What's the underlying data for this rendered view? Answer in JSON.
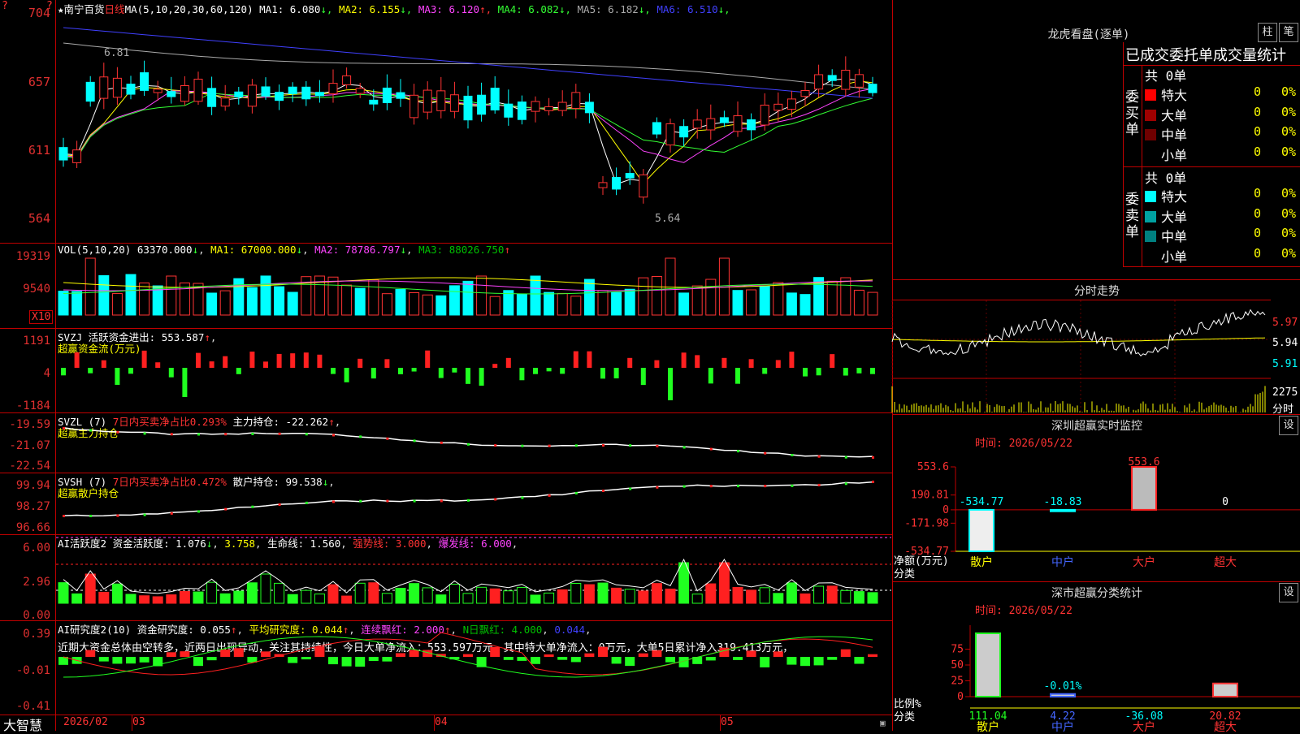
{
  "stock": {
    "name": "南宁百货",
    "star": "★",
    "period": "日线",
    "ma_header": "MA(5,10,20,30,60,120)",
    "ma": [
      {
        "label": "MA1: 6.080",
        "arrow": "↓",
        "color": "#ffffff"
      },
      {
        "label": "MA2: 6.155",
        "arrow": "↓",
        "color": "#ffff00"
      },
      {
        "label": "MA3: 6.120",
        "arrow": "↑",
        "color": "#ff44ff"
      },
      {
        "label": "MA4: 6.082",
        "arrow": "↓",
        "color": "#33ff33"
      },
      {
        "label": "MA5: 6.182",
        "arrow": "↓",
        "color": "#aaaaaa"
      },
      {
        "label": "MA6: 6.510",
        "arrow": "↓",
        "color": "#4040ff"
      }
    ],
    "y_ticks": [
      "704",
      "657",
      "611",
      "564"
    ],
    "high_label": "6.81",
    "low_label": "5.64",
    "top_marker": "?"
  },
  "vol": {
    "header": "VOL(5,10,20)",
    "value": "63370.000",
    "ma1": "MA1: 67000.000",
    "ma2": "MA2: 78786.797",
    "ma3": "MA3: 88026.750",
    "y_ticks": [
      "19319",
      "9540"
    ],
    "unit": "X10"
  },
  "svzj": {
    "header": "SVZJ",
    "label": "活跃资金进出: 553.587",
    "arrow": "↑",
    "subtitle": "超赢资金流(万元)",
    "y_ticks": [
      "1191",
      "4",
      "-1184"
    ]
  },
  "svzl": {
    "header": "SVZL (7)",
    "ratio": "7日内买卖净占比0.293%",
    "hold": "主力持仓: -22.262",
    "arrow": "↑",
    "subtitle": "超赢主力持仓",
    "y_ticks": [
      "-19.59",
      "-21.07",
      "-22.54"
    ]
  },
  "svsh": {
    "header": "SVSH (7)",
    "ratio": "7日内买卖净占比0.472%",
    "hold": "散户持仓: 99.538",
    "arrow": "↓",
    "subtitle": "超赢散户持仓",
    "y_ticks": [
      "99.94",
      "98.27",
      "96.66"
    ]
  },
  "ai2": {
    "header": "AI活跃度2",
    "activity": "资金活跃度: 1.076",
    "activity_arrow": "↓",
    "v2": "3.758",
    "life": "生命线: 1.560",
    "strong": "强势线: 3.000",
    "burst": "爆发线: 6.000",
    "y_ticks": [
      "6.00",
      "2.96",
      "0.00"
    ]
  },
  "ai_research": {
    "header": "AI研究度2(10)",
    "research": "资金研究度: 0.055",
    "avg": "平均研究度: 0.044",
    "consec": "连续飘红: 2.000",
    "ndays": "N日飘红: 4.000",
    "last": "0.044",
    "comment": "近期大资金总体由空转多，近两日出现异动，关注其持续性，今日大单净流入：553.597万元，其中特大单净流入：0万元，大单5日累计净入319.413万元，",
    "y_ticks": [
      "0.39",
      "-0.01",
      "-0.41"
    ]
  },
  "footer": {
    "brand": "大智慧",
    "months": [
      "2026/02",
      "03",
      "04",
      "05"
    ]
  },
  "right": {
    "dragon_title": "龙虎看盘(逐单)",
    "tab_bar": "柱",
    "tab_pen": "笔",
    "order_stats_title": "已成交委托单成交量统计",
    "buy_side": "委买单",
    "sell_side": "委卖单",
    "buy_total": "共 0单",
    "sell_total": "共 0单",
    "buy_rows": [
      {
        "label": "特大",
        "count": "0",
        "pct": "0%",
        "color": "#ff0000"
      },
      {
        "label": "大单",
        "count": "0",
        "pct": "0%",
        "color": "#a00000"
      },
      {
        "label": "中单",
        "count": "0",
        "pct": "0%",
        "color": "#700000"
      },
      {
        "label": "小单",
        "count": "0",
        "pct": "0%",
        "color": "#000000"
      }
    ],
    "sell_rows": [
      {
        "label": "特大",
        "count": "0",
        "pct": "0%",
        "color": "#00ffff"
      },
      {
        "label": "大单",
        "count": "0",
        "pct": "0%",
        "color": "#00a0a0"
      },
      {
        "label": "中单",
        "count": "0",
        "pct": "0%",
        "color": "#008080"
      },
      {
        "label": "小单",
        "count": "0",
        "pct": "0%",
        "color": "#000000"
      }
    ],
    "intraday_title": "分时走势",
    "intraday_ticks": [
      "5.97",
      "5.94",
      "5.91"
    ],
    "intraday_vol": "2275",
    "intraday_vol_unit": "分时",
    "monitor_title": "深圳超赢实时监控",
    "monitor_time": "时间: 2026/05/22",
    "monitor_settings": "设",
    "monitor_ticks": [
      "553.6",
      "190.81",
      "0",
      "-171.98",
      "-534.77"
    ],
    "monitor_ylabel": "净额(万元)",
    "monitor_xlabel": "分类",
    "monitor_cats": [
      "散户",
      "中户",
      "大户",
      "超大"
    ],
    "monitor_values": [
      -534.77,
      -18.83,
      553.6,
      0
    ],
    "monitor_value_labels": [
      "-534.77",
      "-18.83",
      "553.6",
      "0"
    ],
    "class_title": "深市超赢分类统计",
    "class_time": "时间: 2026/05/22",
    "class_settings": "设",
    "class_ticks": [
      "75",
      "50",
      "25",
      "0"
    ],
    "class_ylabel": "比例%",
    "class_xlabel": "分类",
    "class_cats": [
      "散户",
      "中户",
      "大户",
      "超大"
    ],
    "class_values": [
      111.04,
      4.22,
      -36.08,
      20.82
    ],
    "class_value_labels": [
      "111.04",
      "4.22",
      "-36.08",
      "20.82"
    ],
    "class_extra_label": "-0.01%"
  }
}
